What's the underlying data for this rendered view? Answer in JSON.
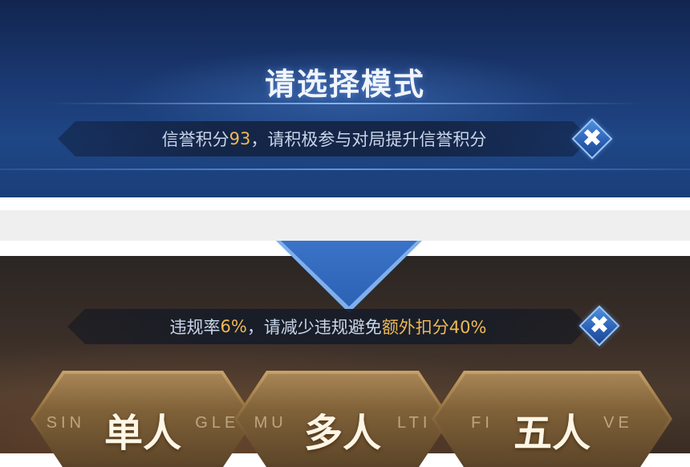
{
  "top": {
    "title": "请选择模式",
    "notice": {
      "prefix": "信誉积分",
      "score": "93",
      "suffix": "，请积极参与对局提升信誉积分"
    },
    "close_glyph": "✖"
  },
  "bottom": {
    "notice": {
      "prefix": "违规率",
      "rate": "6%",
      "middle": "，请减少违规避免",
      "penalty": "额外扣分40%"
    },
    "close_glyph": "✖",
    "modes": [
      {
        "zh": "单人",
        "en_left": "SIN",
        "en_right": "GLE"
      },
      {
        "zh": "多人",
        "en_left": "MU",
        "en_right": "LTI"
      },
      {
        "zh": "五人",
        "en_left": "FI",
        "en_right": "VE"
      }
    ]
  },
  "colors": {
    "accent_gold": "#f0b855",
    "notice_text": "#c9d6ea",
    "top_bg": "#1b3a74",
    "close_blue": "#2a5fb4"
  },
  "icons": {
    "close": "close-icon"
  }
}
